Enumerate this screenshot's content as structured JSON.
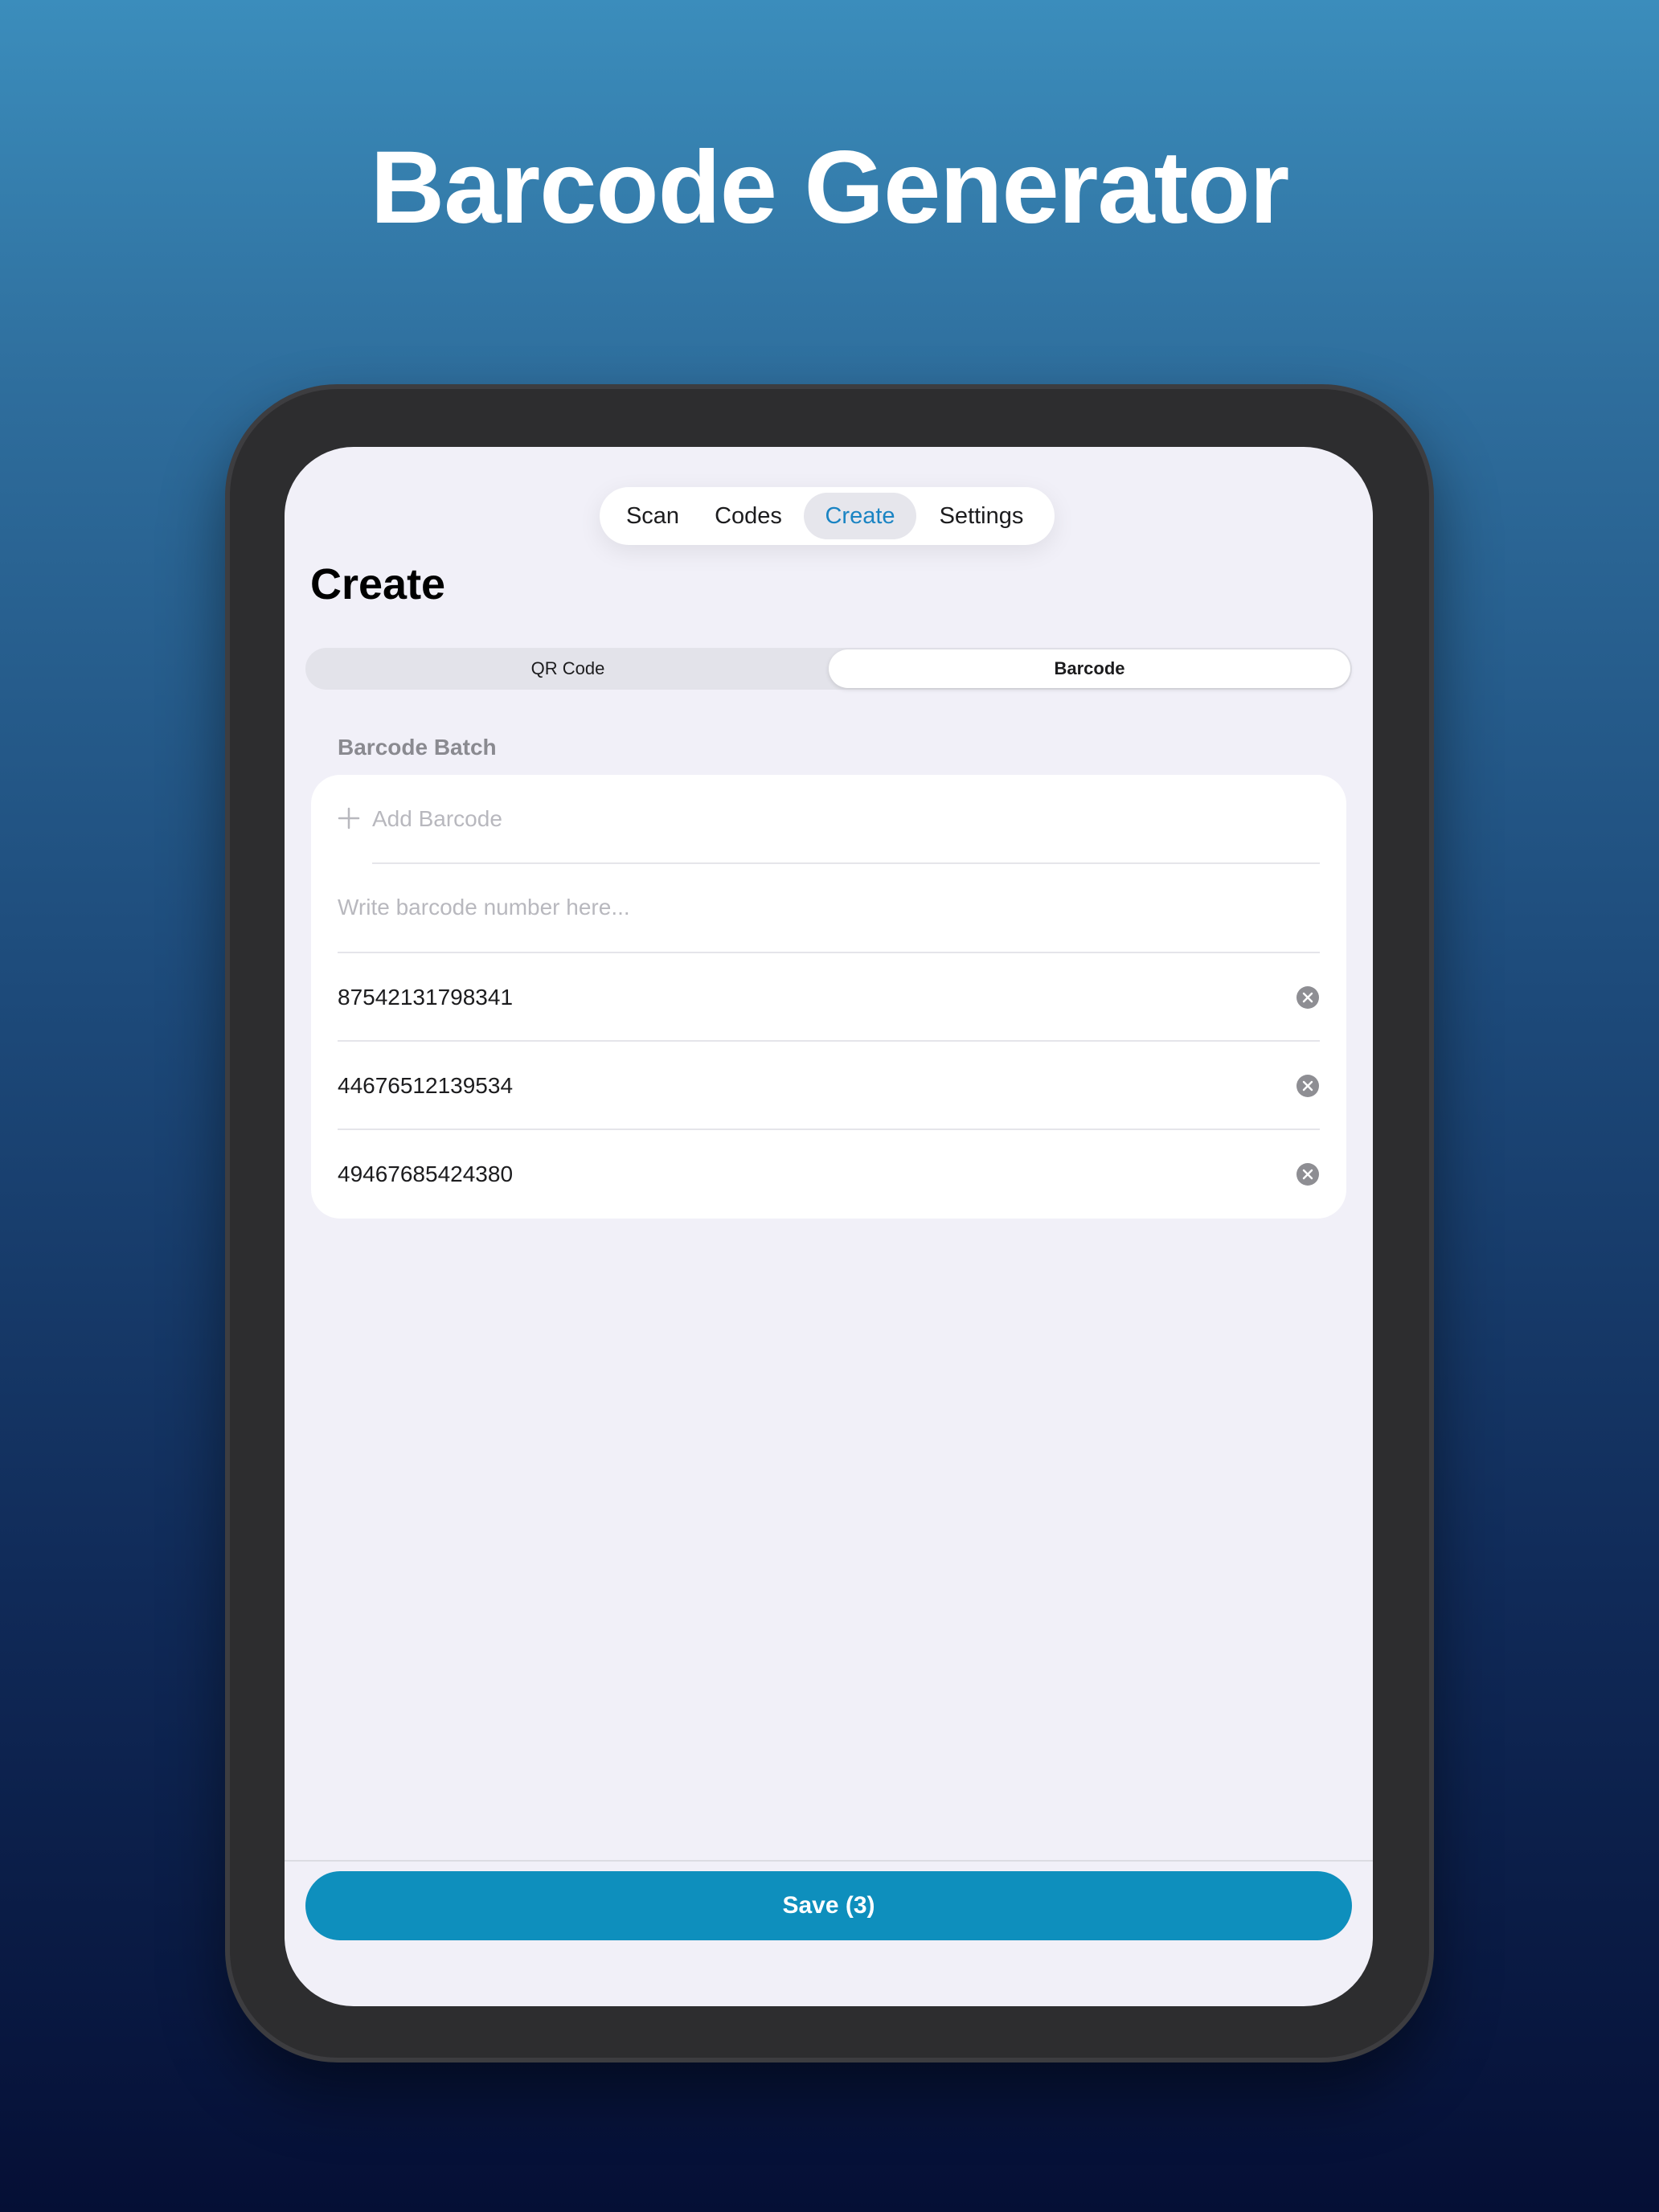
{
  "headline": "Barcode Generator",
  "nav": {
    "items": [
      {
        "label": "Scan",
        "active": false
      },
      {
        "label": "Codes",
        "active": false
      },
      {
        "label": "Create",
        "active": true
      },
      {
        "label": "Settings",
        "active": false
      }
    ]
  },
  "page_title": "Create",
  "segment": {
    "options": [
      "QR Code",
      "Barcode"
    ],
    "selected": "Barcode"
  },
  "section_label": "Barcode Batch",
  "add_label": "Add Barcode",
  "input": {
    "placeholder": "Write barcode number here...",
    "value": ""
  },
  "barcodes": [
    "87542131798341",
    "44676512139534",
    "49467685424380"
  ],
  "save_label": "Save (3)",
  "colors": {
    "accent": "#0e8fbd",
    "active_tab_text": "#1a84c3",
    "background_top": "#3b8dbc",
    "background_bottom": "#050f35"
  },
  "icons": {
    "add": "plus-icon",
    "clear": "clear-circle-icon"
  }
}
